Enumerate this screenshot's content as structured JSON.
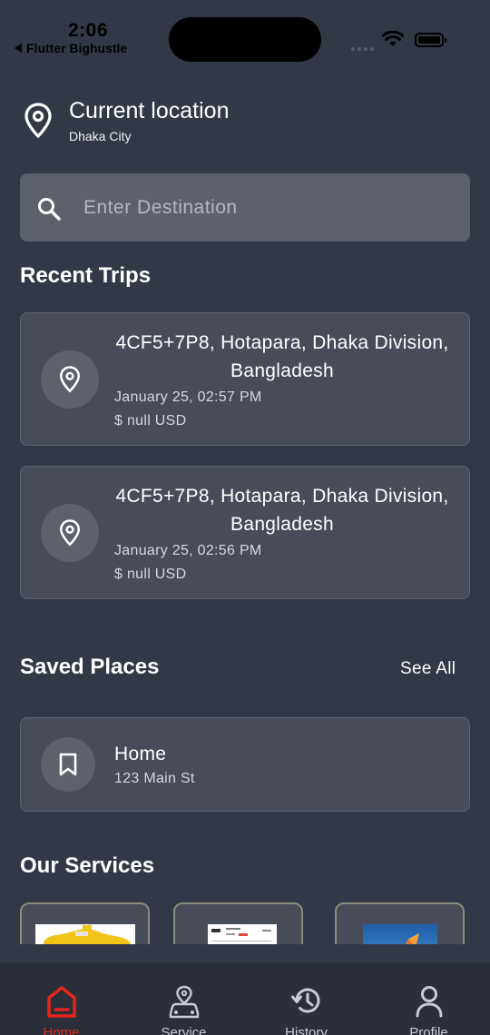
{
  "status_bar": {
    "time": "2:06",
    "back_app": "Flutter Bighustle"
  },
  "location": {
    "title": "Current location",
    "subtitle": "Dhaka City"
  },
  "search": {
    "placeholder": "Enter Destination"
  },
  "recent_trips": {
    "title": "Recent Trips",
    "items": [
      {
        "address": "4CF5+7P8, Hotapara, Dhaka Division, Bangladesh",
        "date": "January 25, 02:57 PM",
        "price": "$ null USD"
      },
      {
        "address": "4CF5+7P8, Hotapara, Dhaka Division, Bangladesh",
        "date": "January 25, 02:56 PM",
        "price": "$ null USD"
      }
    ]
  },
  "saved_places": {
    "title": "Saved Places",
    "see_all": "See All",
    "items": [
      {
        "name": "Home",
        "address": "123 Main St"
      }
    ]
  },
  "services": {
    "title": "Our Services",
    "items": [
      {
        "icon": "taxi-image"
      },
      {
        "icon": "document-image"
      },
      {
        "icon": "photo-image"
      }
    ]
  },
  "bottom_nav": {
    "items": [
      {
        "label": "Home",
        "icon": "home-icon",
        "active": true
      },
      {
        "label": "Service",
        "icon": "car-location-icon",
        "active": false
      },
      {
        "label": "History",
        "icon": "history-icon",
        "active": false
      },
      {
        "label": "Profile",
        "icon": "person-icon",
        "active": false
      }
    ]
  },
  "colors": {
    "background": "#323846",
    "card": "#474c58",
    "search_bg": "#5c616c",
    "active_accent": "#e8261c",
    "nav_bg": "#2a2f3a"
  }
}
